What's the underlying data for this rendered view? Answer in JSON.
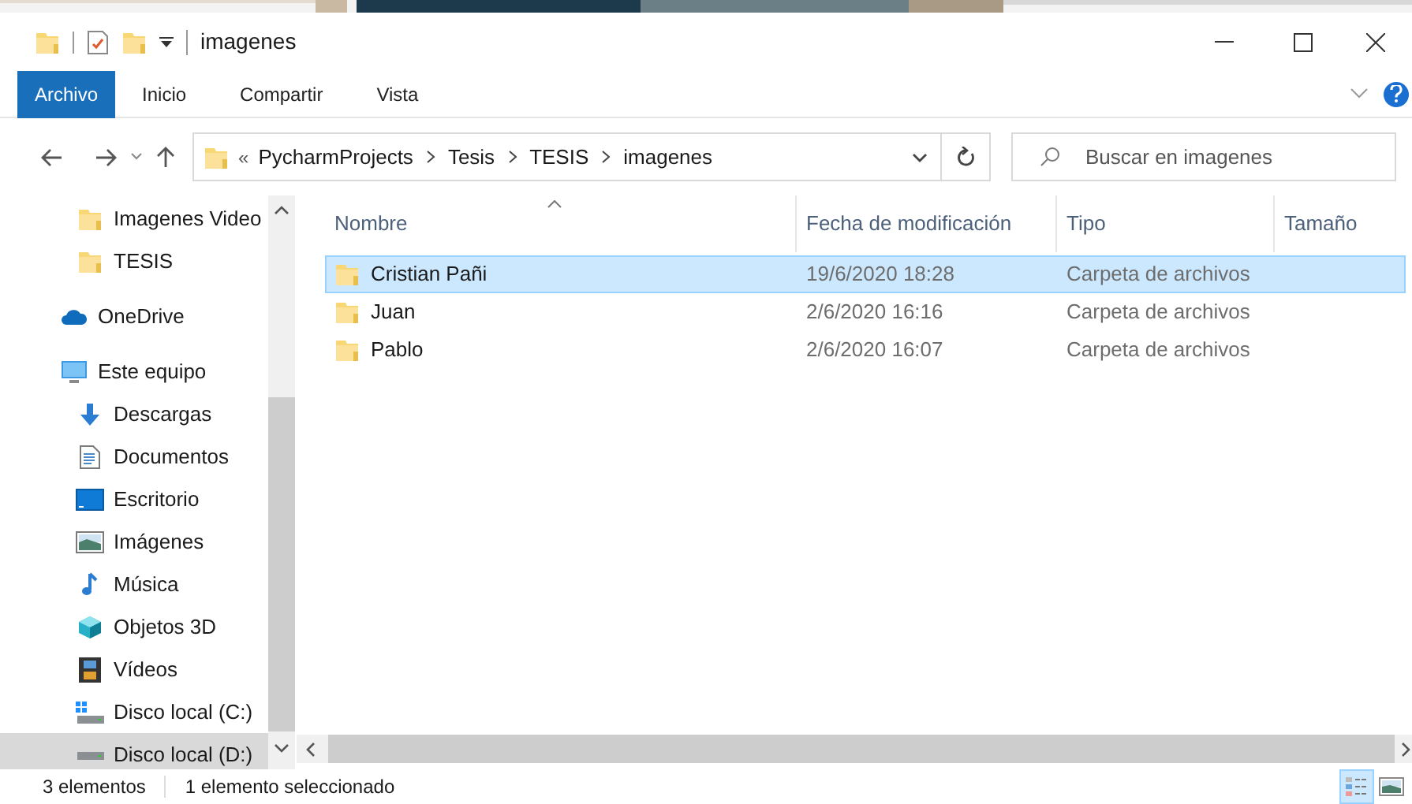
{
  "window": {
    "title": "imagenes"
  },
  "ribbon_tabs": [
    {
      "label": "Archivo",
      "selected": true
    },
    {
      "label": "Inicio",
      "selected": false
    },
    {
      "label": "Compartir",
      "selected": false
    },
    {
      "label": "Vista",
      "selected": false
    }
  ],
  "address_bar": {
    "overflow": "«",
    "path": [
      "PycharmProjects",
      "Tesis",
      "TESIS",
      "imagenes"
    ]
  },
  "search": {
    "placeholder": "Buscar en imagenes"
  },
  "sidebar": {
    "quick_access_items": [
      {
        "label": "Imagenes Video",
        "kind": "folder",
        "selected": false
      },
      {
        "label": "TESIS",
        "kind": "folder",
        "selected": false
      }
    ],
    "items": [
      {
        "label": "OneDrive",
        "kind": "cloud",
        "selected": false
      },
      {
        "label": "Este equipo",
        "kind": "computer",
        "selected": false,
        "children": [
          {
            "label": "Descargas",
            "kind": "downloads",
            "selected": false
          },
          {
            "label": "Documentos",
            "kind": "documents",
            "selected": false
          },
          {
            "label": "Escritorio",
            "kind": "desktop",
            "selected": false
          },
          {
            "label": "Imágenes",
            "kind": "pictures",
            "selected": false
          },
          {
            "label": "Música",
            "kind": "music",
            "selected": false
          },
          {
            "label": "Objetos 3D",
            "kind": "objects",
            "selected": false
          },
          {
            "label": "Vídeos",
            "kind": "videos",
            "selected": false
          },
          {
            "label": "Disco local (C:)",
            "kind": "system-drive",
            "selected": false
          },
          {
            "label": "Disco local (D:)",
            "kind": "drive",
            "selected": true
          }
        ]
      }
    ]
  },
  "table": {
    "columns": [
      "Nombre",
      "Fecha de modificación",
      "Tipo",
      "Tamaño"
    ],
    "rows": [
      {
        "name": "Cristian Pañi",
        "date": "19/6/2020 18:28",
        "type": "Carpeta de archivos",
        "selected": true
      },
      {
        "name": "Juan",
        "date": "2/6/2020 16:16",
        "type": "Carpeta de archivos",
        "selected": false
      },
      {
        "name": "Pablo",
        "date": "2/6/2020 16:07",
        "type": "Carpeta de archivos",
        "selected": false
      }
    ]
  },
  "status_bar": {
    "count": "3 elementos",
    "selection": "1 elemento seleccionado"
  },
  "view_buttons": [
    {
      "kind": "details",
      "selected": true
    },
    {
      "kind": "thumbnails",
      "selected": false
    }
  ]
}
